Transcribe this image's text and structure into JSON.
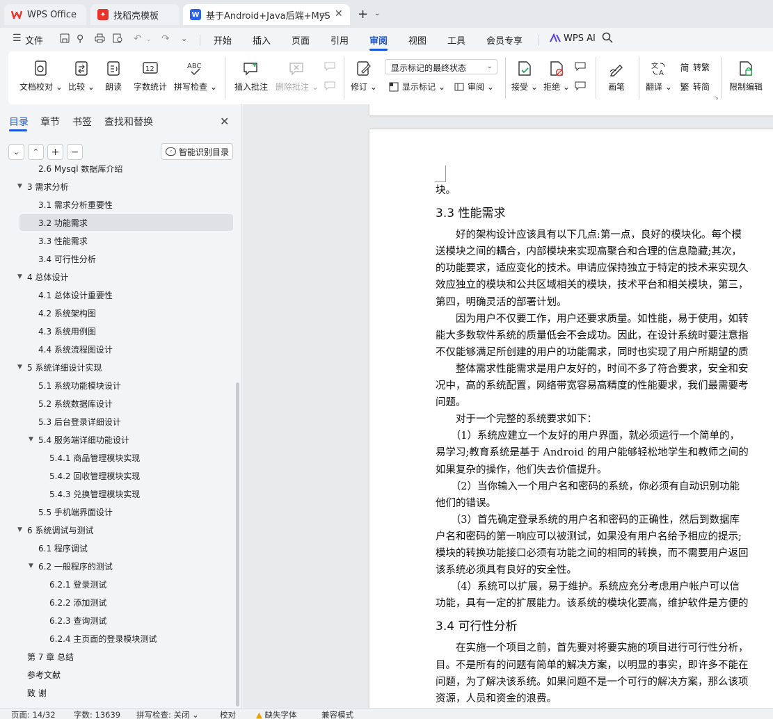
{
  "tabs": [
    {
      "label": "WPS Office"
    },
    {
      "label": "找稻壳模板"
    },
    {
      "label": "基于Android+Java后端+MyS"
    }
  ],
  "menu": {
    "file": "文件",
    "items": [
      "开始",
      "插入",
      "页面",
      "引用",
      "审阅",
      "视图",
      "工具",
      "会员专享"
    ],
    "active": "审阅",
    "wps_ai": "WPS AI"
  },
  "ribbon": {
    "doc_check": "文档校对",
    "compare": "比较",
    "read_aloud": "朗读",
    "word_count": "字数统计",
    "spell_check": "拼写检查",
    "insert_comment": "插入批注",
    "delete_comment": "删除批注",
    "revise": "修订",
    "markup_select": "显示标记的最终状态",
    "show_markup": "显示标记",
    "review": "审阅",
    "accept": "接受",
    "reject": "拒绝",
    "pen": "画笔",
    "translate": "翻译",
    "to_traditional": "转繁",
    "to_simplified": "转简",
    "restrict_edit": "限制编辑"
  },
  "sidebar": {
    "tabs": [
      "目录",
      "章节",
      "书签",
      "查找和替换"
    ],
    "smart_toc": "智能识别目录",
    "toc": [
      {
        "label": "2.6 Mysql 数据库介绍",
        "level": 2
      },
      {
        "label": "3  需求分析",
        "level": 1,
        "expanded": true
      },
      {
        "label": "3.1  需求分析重要性",
        "level": 2
      },
      {
        "label": "3.2  功能需求",
        "level": 2,
        "selected": true
      },
      {
        "label": "3.3  性能需求",
        "level": 2
      },
      {
        "label": "3.4  可行性分析",
        "level": 2
      },
      {
        "label": "4  总体设计",
        "level": 1,
        "expanded": true
      },
      {
        "label": "4.1  总体设计重要性",
        "level": 2
      },
      {
        "label": "4.2  系统架构图",
        "level": 2
      },
      {
        "label": "4.3  系统用例图",
        "level": 2
      },
      {
        "label": "4.4  系统流程图设计",
        "level": 2
      },
      {
        "label": "5  系统详细设计实现",
        "level": 1,
        "expanded": true
      },
      {
        "label": "5.1  系统功能模块设计",
        "level": 2
      },
      {
        "label": "5.2  系统数据库设计",
        "level": 2
      },
      {
        "label": "5.3  后台登录详细设计",
        "level": 2
      },
      {
        "label": "5.4  服务端详细功能设计",
        "level": 2,
        "expanded": true
      },
      {
        "label": "5.4.1  商品管理模块实现",
        "level": 3
      },
      {
        "label": "5.4.2  回收管理模块实现",
        "level": 3
      },
      {
        "label": "5.4.3  兑换管理模块实现",
        "level": 3
      },
      {
        "label": "5.5  手机端界面设计",
        "level": 2
      },
      {
        "label": "6  系统调试与测试",
        "level": 1,
        "expanded": true
      },
      {
        "label": "6.1  程序调试",
        "level": 2
      },
      {
        "label": "6.2  一般程序的测试",
        "level": 2,
        "expanded": true
      },
      {
        "label": "6.2.1  登录测试",
        "level": 3
      },
      {
        "label": "6.2.2  添加测试",
        "level": 3
      },
      {
        "label": "6.2.3  查询测试",
        "level": 3
      },
      {
        "label": "6.2.4  主页面的登录模块测试",
        "level": 3
      },
      {
        "label": "第 7 章  总结",
        "level": 1
      },
      {
        "label": "参考文献",
        "level": 1
      },
      {
        "label": "致  谢",
        "level": 1
      }
    ]
  },
  "document": {
    "lines": [
      {
        "t": "块。",
        "kind": "p"
      },
      {
        "t": "3.3  性能需求",
        "kind": "h"
      },
      {
        "t": "　　好的架构设计应该具有以下几点:第一点，良好的模块化。每个模",
        "kind": "p"
      },
      {
        "t": "送模块之间的耦合，内部模块来实现高聚合和合理的信息隐藏;其次，",
        "kind": "p"
      },
      {
        "t": "的功能要求，适应变化的技术。申请应保持独立于特定的技术来实现久",
        "kind": "p"
      },
      {
        "t": "效应独立的模块和公共区域相关的模块，技术平台和相关模块，第三，",
        "kind": "p"
      },
      {
        "t": "第四，明确灵活的部署计划。",
        "kind": "p"
      },
      {
        "t": "　　因为用户不仅要工作，用户还要求质量。如性能，易于使用，如转",
        "kind": "p"
      },
      {
        "t": "能大多数软件系统的质量低会不会成功。因此，在设计系统时要注意指",
        "kind": "p"
      },
      {
        "t": "不仅能够满足所创建的用户的功能需求，同时也实现了用户所期望的质",
        "kind": "p"
      },
      {
        "t": "　　整体需求性能需求是用户友好的，时间不多了符合要求，安全和安",
        "kind": "p"
      },
      {
        "t": "况中，高的系统配置，网络带宽容易高精度的性能要求，我们最需要考",
        "kind": "p"
      },
      {
        "t": "问题。",
        "kind": "p"
      },
      {
        "t": "　　对于一个完整的系统要求如下：",
        "kind": "p"
      },
      {
        "t": "　　（1）系统应建立一个友好的用户界面，就必须运行一个简单的，",
        "kind": "p"
      },
      {
        "t": "易学习;教育系统是基于 Android 的用户能够轻松地学生和教师之间的",
        "kind": "p"
      },
      {
        "t": "如果复杂的操作，他们失去价值提升。",
        "kind": "p"
      },
      {
        "t": "　　（2）当你输入一个用户名和密码的系统，你必须有自动识别功能",
        "kind": "p"
      },
      {
        "t": "他们的错误。",
        "kind": "p"
      },
      {
        "t": "　　（3）首先确定登录系统的用户名和密码的正确性，然后到数据库",
        "kind": "p"
      },
      {
        "t": "户名和密码的第一响应可以被测试，如果没有用户名给予相应的提示;",
        "kind": "p"
      },
      {
        "t": "模块的转换功能接口必须有功能之间的相同的转换，而不需要用户返回",
        "kind": "p"
      },
      {
        "t": "该系统必须具有良好的安全性。",
        "kind": "p"
      },
      {
        "t": "　　（4）系统可以扩展，易于维护。系统应充分考虑用户帐户可以信",
        "kind": "p"
      },
      {
        "t": "功能，具有一定的扩展能力。该系统的模块化要高，维护软件是方便的",
        "kind": "p"
      },
      {
        "t": "3.4  可行性分析",
        "kind": "h"
      },
      {
        "t": "　　在实施一个项目之前，首先要对将要实施的项目进行可行性分析，",
        "kind": "p"
      },
      {
        "t": "目。不是所有的问题有简单的解决方案，以明显的事实，即许多不能在",
        "kind": "p"
      },
      {
        "t": "问题，为了解决该系统。如果问题不是一个可行的解决方案，那么该项",
        "kind": "p"
      },
      {
        "t": "资源，人员和资金的浪费。",
        "kind": "p"
      }
    ]
  },
  "status": {
    "page": "页面: 14/32",
    "words": "字数: 13639",
    "spell": "拼写检查: 关闭",
    "proof": "校对",
    "missing_font": "缺失字体",
    "compat": "兼容模式"
  },
  "colors": {
    "accent": "#1a56db",
    "wps_red": "#e8332a"
  }
}
